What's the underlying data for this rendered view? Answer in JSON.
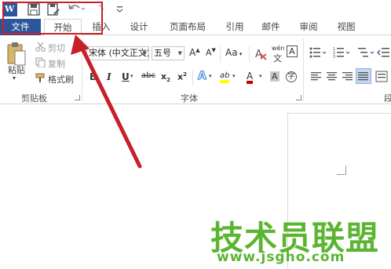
{
  "qat": {
    "icons": [
      "word-logo",
      "save",
      "save-as",
      "undo",
      "redo",
      "customize"
    ],
    "word_letter": "W"
  },
  "tabs": [
    {
      "label": "文件"
    },
    {
      "label": "开始"
    },
    {
      "label": "插入"
    },
    {
      "label": "设计"
    },
    {
      "label": "页面布局"
    },
    {
      "label": "引用"
    },
    {
      "label": "邮件"
    },
    {
      "label": "审阅"
    },
    {
      "label": "视图"
    }
  ],
  "clipboard": {
    "paste": "粘贴",
    "cut": "剪切",
    "copy": "复制",
    "format_painter": "格式刷",
    "group_label": "剪贴板"
  },
  "font": {
    "font_name": "宋体 (中文正文)",
    "font_size": "五号",
    "grow": "A",
    "shrink": "A",
    "change_case": "Aa",
    "clear_format": "A",
    "phonetic": "wén",
    "char_border": "A",
    "bold": "B",
    "italic": "I",
    "underline": "U",
    "strikethrough": "abc",
    "subscript": "x",
    "superscript": "x",
    "text_effect": "A",
    "highlight": "ab",
    "font_color": "A",
    "char_shading": "A",
    "enclose": "字",
    "group_label": "字体"
  },
  "paragraph": {
    "group_label": "段"
  },
  "colors": {
    "word_blue": "#2b579a",
    "annotation_red": "#c8202a",
    "watermark_green": "#5cb531",
    "highlight_yellow": "#ffff00",
    "font_red": "#c00000"
  },
  "watermark": {
    "text": "技术员联盟",
    "url": "www.jsgho.com"
  }
}
